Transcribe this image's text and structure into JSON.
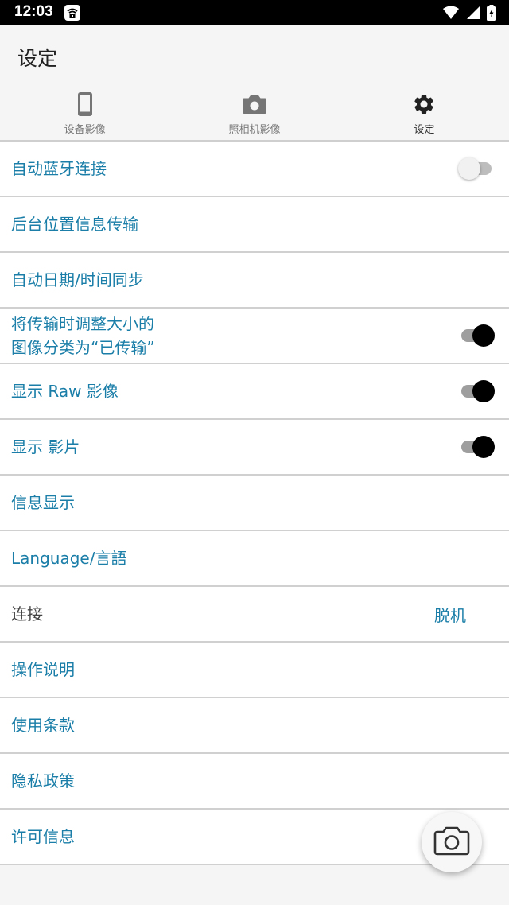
{
  "status_bar": {
    "time": "12:03"
  },
  "header": {
    "title": "设定",
    "tabs": [
      {
        "label": "设备影像",
        "icon": "phone-icon",
        "active": false
      },
      {
        "label": "照相机影像",
        "icon": "camera-icon",
        "active": false
      },
      {
        "label": "设定",
        "icon": "gear-icon",
        "active": true
      }
    ]
  },
  "settings": {
    "items": [
      {
        "label": "自动蓝牙连接",
        "toggle": "off"
      },
      {
        "label": "后台位置信息传输"
      },
      {
        "label": "自动日期/时间同步"
      },
      {
        "label_line1": "将传输时调整大小的",
        "label_line2": "图像分类为“已传输”",
        "toggle": "on"
      },
      {
        "label": "显示 Raw 影像",
        "toggle": "on"
      },
      {
        "label": "显示 影片",
        "toggle": "on"
      },
      {
        "label": "信息显示"
      },
      {
        "label": "Language/言語"
      },
      {
        "label": "连接",
        "value": "脱机"
      },
      {
        "label": "操作说明"
      },
      {
        "label": "使用条款"
      },
      {
        "label": "隐私政策"
      },
      {
        "label": "许可信息"
      }
    ]
  },
  "colors": {
    "accent": "#1a7ea8",
    "status_bar": "#000000",
    "background": "#f5f5f5"
  }
}
